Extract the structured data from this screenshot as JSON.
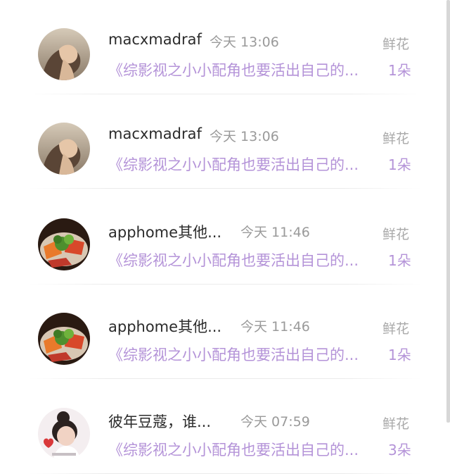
{
  "gifts": [
    {
      "avatar": "woman-profile-sky-avatar",
      "name": "macxmadraf",
      "time": "今天 13:06",
      "gift_label": "鲜花",
      "work": "《综影视之小小配角也要活出自己的...",
      "count": "1朵"
    },
    {
      "avatar": "woman-profile-sky-avatar",
      "name": "macxmadraf",
      "time": "今天 13:06",
      "gift_label": "鲜花",
      "work": "《综影视之小小配角也要活出自己的...",
      "count": "1朵"
    },
    {
      "avatar": "food-plate-avatar",
      "name": "apphome其他...",
      "time": "今天 11:46",
      "gift_label": "鲜花",
      "work": "《综影视之小小配角也要活出自己的...",
      "count": "1朵"
    },
    {
      "avatar": "food-plate-avatar",
      "name": "apphome其他...",
      "time": "今天 11:46",
      "gift_label": "鲜花",
      "work": "《综影视之小小配角也要活出自己的...",
      "count": "1朵"
    },
    {
      "avatar": "girl-bun-heart-avatar",
      "name": "彼年豆蔻，谁...",
      "time": "今天 07:59",
      "gift_label": "鲜花",
      "work": "《综影视之小小配角也要活出自己的...",
      "count": "3朵"
    }
  ]
}
